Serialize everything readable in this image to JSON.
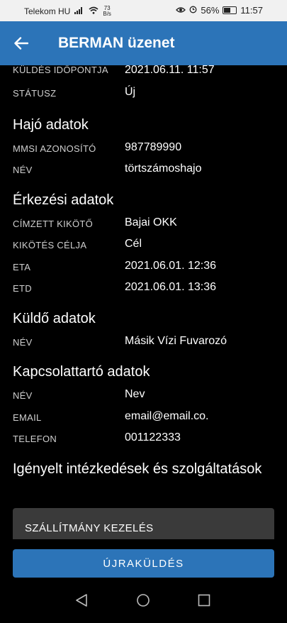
{
  "status_bar": {
    "carrier": "Telekom HU",
    "speed_value": "73",
    "speed_unit": "B/s",
    "battery_percent": "56%",
    "battery_level": 0.56,
    "time": "11:57"
  },
  "app_bar": {
    "title": "BERMAN üzenet"
  },
  "details": [
    {
      "label": "KÜLDÉS IDŐPONTJA",
      "value": "2021.06.11. 11:57"
    },
    {
      "label": "STÁTUSZ",
      "value": "Új"
    }
  ],
  "sections": [
    {
      "title": "Hajó adatok",
      "rows": [
        {
          "label": "MMSI AZONOSÍTÓ",
          "value": "987789990"
        },
        {
          "label": "NÉV",
          "value": "törtszámoshajo"
        }
      ]
    },
    {
      "title": "Érkezési adatok",
      "rows": [
        {
          "label": "CÍMZETT KIKÖTŐ",
          "value": "Bajai OKK"
        },
        {
          "label": "KIKÖTÉS CÉLJA",
          "value": "Cél"
        },
        {
          "label": "ETA",
          "value": "2021.06.01. 12:36"
        },
        {
          "label": "ETD",
          "value": "2021.06.01. 13:36"
        }
      ]
    },
    {
      "title": "Küldő adatok",
      "rows": [
        {
          "label": "NÉV",
          "value": "Másik Vízi Fuvarozó"
        }
      ]
    },
    {
      "title": "Kapcsolattartó adatok",
      "rows": [
        {
          "label": "NÉV",
          "value": "Nev"
        },
        {
          "label": "EMAIL",
          "value": "email@email.co."
        },
        {
          "label": "TELEFON",
          "value": "001122333"
        }
      ]
    },
    {
      "title": "Igényelt intézkedések és szolgáltatások",
      "rows": []
    }
  ],
  "card": {
    "title": "SZÁLLÍTMÁNY KEZELÉS"
  },
  "resend_button": {
    "label": "ÚJRAKÜLDÉS"
  },
  "colors": {
    "accent": "#2c74b8",
    "background": "#000000",
    "card": "#3a3a3a"
  },
  "icons": [
    "signal-icon",
    "wifi-icon",
    "eye-icon",
    "alarm-icon",
    "battery-icon",
    "back-arrow-icon",
    "nav-back-icon",
    "nav-home-icon",
    "nav-recents-icon"
  ]
}
